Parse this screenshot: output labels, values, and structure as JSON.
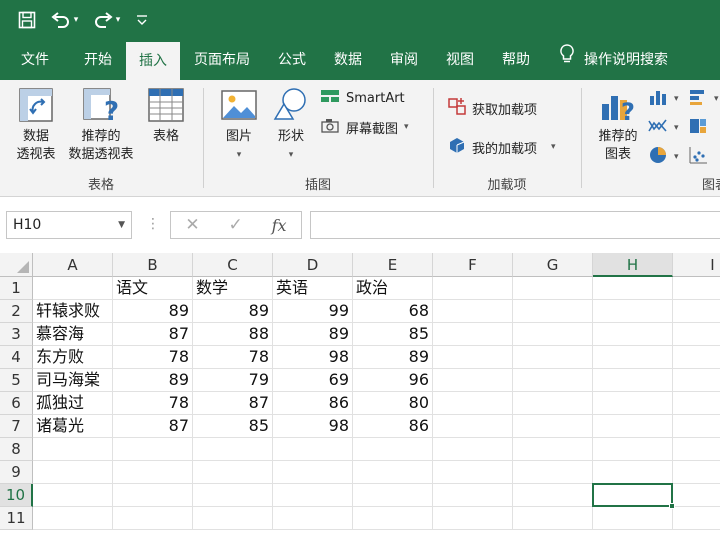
{
  "qat": {
    "icons": [
      "save-icon",
      "undo-icon",
      "redo-icon",
      "customize-icon"
    ]
  },
  "tabs": [
    {
      "label": "文件"
    },
    {
      "label": "开始"
    },
    {
      "label": "插入",
      "active": true
    },
    {
      "label": "页面布局"
    },
    {
      "label": "公式"
    },
    {
      "label": "数据"
    },
    {
      "label": "审阅"
    },
    {
      "label": "视图"
    },
    {
      "label": "帮助"
    }
  ],
  "tell_me": {
    "label": "操作说明搜索",
    "icon": "lightbulb-icon"
  },
  "ribbon": {
    "tables": {
      "label": "表格",
      "pivot": [
        "数据",
        "透视表"
      ],
      "recommended_pivot": [
        "推荐的",
        "数据透视表"
      ],
      "table": "表格"
    },
    "illustrations": {
      "label": "插图",
      "pictures": "图片",
      "shapes": "形状",
      "smartart": "SmartArt",
      "screenshot": "屏幕截图"
    },
    "addins": {
      "label": "加载项",
      "get_addins": "获取加载项",
      "my_addins": "我的加载项"
    },
    "charts": {
      "recommended": [
        "推荐的",
        "图表"
      ],
      "label": "图表"
    }
  },
  "formula_bar": {
    "name_box": "H10",
    "cancel": "✕",
    "enter": "✓",
    "fx": "fx",
    "value": ""
  },
  "sheet": {
    "columns": [
      "A",
      "B",
      "C",
      "D",
      "E",
      "F",
      "G",
      "H",
      "I"
    ],
    "selected_column": "H",
    "rows": [
      "1",
      "2",
      "3",
      "4",
      "5",
      "6",
      "7",
      "8",
      "9",
      "10",
      "11"
    ],
    "selected_row": "10",
    "header": [
      "",
      "语文",
      "数学",
      "英语",
      "政治"
    ],
    "data": [
      [
        "轩辕求败",
        89,
        89,
        99,
        68
      ],
      [
        "慕容海",
        87,
        88,
        89,
        85
      ],
      [
        "东方败",
        78,
        78,
        98,
        89
      ],
      [
        "司马海棠",
        89,
        79,
        69,
        96
      ],
      [
        "孤独过",
        78,
        87,
        86,
        80
      ],
      [
        "诸葛光",
        87,
        85,
        98,
        86
      ]
    ],
    "active_cell": "H10"
  },
  "colors": {
    "accent": "#217346",
    "ribbon_bg": "#f3f3f3"
  }
}
